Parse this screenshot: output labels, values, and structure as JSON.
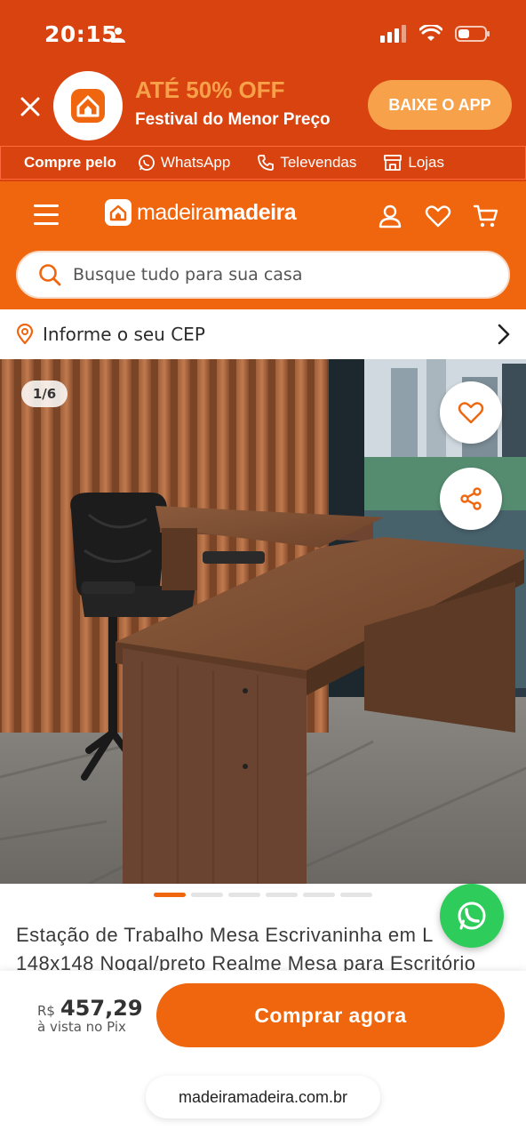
{
  "status_bar": {
    "time": "20:15"
  },
  "promo": {
    "title": "ATÉ 50% OFF",
    "subtitle": "Festival do Menor Preço",
    "cta": "BAIXE O APP"
  },
  "contact_bar": {
    "label": "Compre pelo",
    "items": [
      {
        "label": "WhatsApp",
        "icon": "whatsapp-icon"
      },
      {
        "label": "Televendas",
        "icon": "phone-icon"
      },
      {
        "label": "Lojas",
        "icon": "store-icon"
      }
    ]
  },
  "header": {
    "brand_light": "madeira",
    "brand_bold": "madeira",
    "search_placeholder": "Busque tudo para sua casa"
  },
  "cep": {
    "label": "Informe o seu CEP"
  },
  "gallery": {
    "counter": "1/6",
    "total_images": 6,
    "current_image": 1
  },
  "product": {
    "title": "Estação de Trabalho Mesa Escrivaninha em L 148x148 Nogal/preto Realme Mesa para Escritório"
  },
  "purchase": {
    "currency": "R$",
    "price": "457,29",
    "price_note": "à vista no Pix",
    "cta": "Comprar agora"
  },
  "browser": {
    "url": "madeiramadeira.com.br"
  },
  "colors": {
    "brand_orange": "#f0660e",
    "banner_red": "#d9430f",
    "promo_accent": "#f7a24a",
    "whatsapp_green": "#2ecc5b"
  }
}
